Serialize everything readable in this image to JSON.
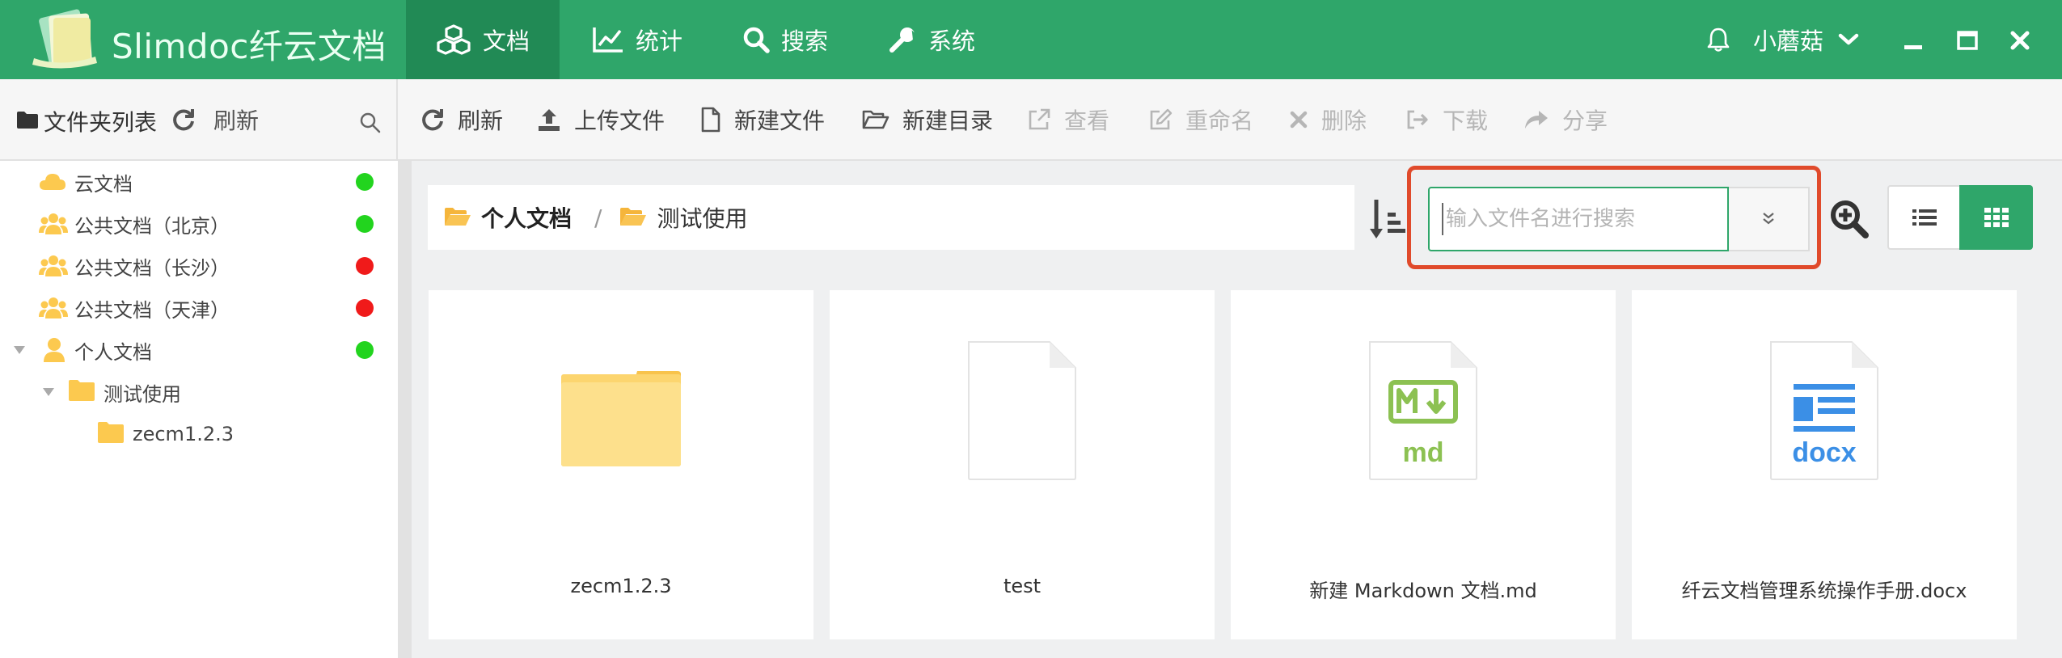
{
  "app": {
    "title": "Slimdoc纤云文档",
    "nav": [
      {
        "label": "文档",
        "icon": "cubes-icon",
        "active": true
      },
      {
        "label": "统计",
        "icon": "line-chart-icon",
        "active": false
      },
      {
        "label": "搜索",
        "icon": "search-icon",
        "active": false
      },
      {
        "label": "系统",
        "icon": "wrench-icon",
        "active": false
      }
    ],
    "user": {
      "name": "小蘑菇"
    }
  },
  "toolbar": {
    "sidebar_title": "文件夹列表",
    "sidebar_refresh": "刷新",
    "actions": [
      {
        "label": "刷新",
        "icon": "refresh-icon",
        "enabled": true
      },
      {
        "label": "上传文件",
        "icon": "upload-icon",
        "enabled": true
      },
      {
        "label": "新建文件",
        "icon": "new-file-icon",
        "enabled": true
      },
      {
        "label": "新建目录",
        "icon": "folder-open-icon",
        "enabled": true
      },
      {
        "label": "查看",
        "icon": "external-link-icon",
        "enabled": false
      },
      {
        "label": "重命名",
        "icon": "edit-icon",
        "enabled": false
      },
      {
        "label": "删除",
        "icon": "times-icon",
        "enabled": false
      },
      {
        "label": "下载",
        "icon": "sign-out-icon",
        "enabled": false
      },
      {
        "label": "分享",
        "icon": "share-icon",
        "enabled": false
      }
    ]
  },
  "tree": [
    {
      "label": "云文档",
      "icon": "cloud-icon",
      "status": "online"
    },
    {
      "label": "公共文档（北京）",
      "icon": "users-icon",
      "status": "online"
    },
    {
      "label": "公共文档（长沙）",
      "icon": "users-icon",
      "status": "offline"
    },
    {
      "label": "公共文档（天津）",
      "icon": "users-icon",
      "status": "offline"
    },
    {
      "label": "个人文档",
      "icon": "user-icon",
      "status": "online",
      "expanded": true
    },
    {
      "label": "测试使用",
      "icon": "folder-icon",
      "expanded": true
    },
    {
      "label": "zecm1.2.3",
      "icon": "folder-icon"
    }
  ],
  "breadcrumb": [
    {
      "label": "个人文档",
      "current": false
    },
    {
      "label": "测试使用",
      "current": true
    }
  ],
  "breadcrumb_separator": "/",
  "search": {
    "placeholder": "输入文件名进行搜索",
    "value": ""
  },
  "files": [
    {
      "name": "zecm1.2.3",
      "type": "folder"
    },
    {
      "name": "test",
      "type": "file"
    },
    {
      "name": "新建 Markdown 文档.md",
      "type": "md",
      "badge": "md"
    },
    {
      "name": "纤云文档管理系统操作手册.docx",
      "type": "docx",
      "badge": "docx"
    }
  ],
  "colors": {
    "primary": "#2fa66a",
    "primary_dark": "#218a55",
    "status_online": "#22d41e",
    "status_offline": "#f01a1a",
    "highlight": "#e04a2b",
    "folder": "#fcd56f",
    "md": "#8cc152",
    "docx": "#3b8fe6"
  },
  "view_mode": "grid"
}
